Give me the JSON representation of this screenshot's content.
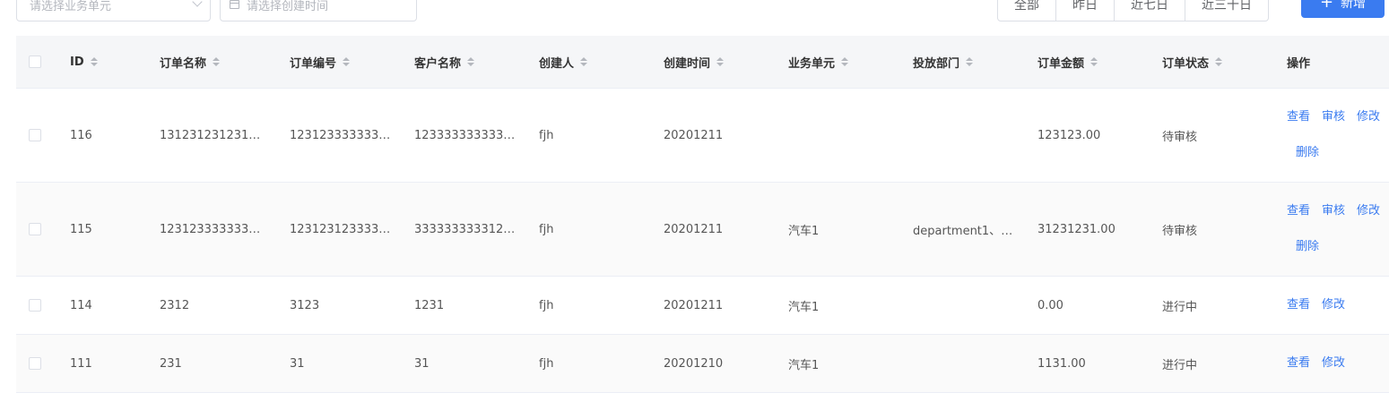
{
  "filters": {
    "business_unit_placeholder": "请选择业务单元",
    "date_placeholder": "请选择创建时间"
  },
  "range_buttons": [
    "全部",
    "昨日",
    "近七日",
    "近三十日"
  ],
  "add_button": {
    "icon": "plus-icon",
    "label": "新增"
  },
  "colors": {
    "accent": "#3a7bf0",
    "header_bg": "#f5f6f8",
    "alt_row_bg": "#fafafa"
  },
  "table": {
    "columns": [
      "ID",
      "订单名称",
      "订单编号",
      "客户名称",
      "创建人",
      "创建时间",
      "业务单元",
      "投放部门",
      "订单金额",
      "订单状态",
      "操作"
    ],
    "rows": [
      {
        "id": "116",
        "name": "1312312312312…",
        "number": "1231233333333…",
        "customer": "1233333333333…",
        "creator": "fjh",
        "created": "20201211",
        "unit": "",
        "dept": "",
        "amount": "123123.00",
        "status": "待审核",
        "actions": [
          "查看",
          "审核",
          "修改",
          "删除"
        ]
      },
      {
        "id": "115",
        "name": "1231233333333…",
        "number": "1231231233333…",
        "customer": "3333333333122…",
        "creator": "fjh",
        "created": "20201211",
        "unit": "汽车1",
        "dept": "department1、d…",
        "amount": "31231231.00",
        "status": "待审核",
        "actions": [
          "查看",
          "审核",
          "修改",
          "删除"
        ]
      },
      {
        "id": "114",
        "name": "2312",
        "number": "3123",
        "customer": "1231",
        "creator": "fjh",
        "created": "20201211",
        "unit": "汽车1",
        "dept": "",
        "amount": "0.00",
        "status": "进行中",
        "actions": [
          "查看",
          "修改"
        ]
      },
      {
        "id": "111",
        "name": "231",
        "number": "31",
        "customer": "31",
        "creator": "fjh",
        "created": "20201210",
        "unit": "汽车1",
        "dept": "",
        "amount": "1131.00",
        "status": "进行中",
        "actions": [
          "查看",
          "修改"
        ]
      }
    ]
  }
}
